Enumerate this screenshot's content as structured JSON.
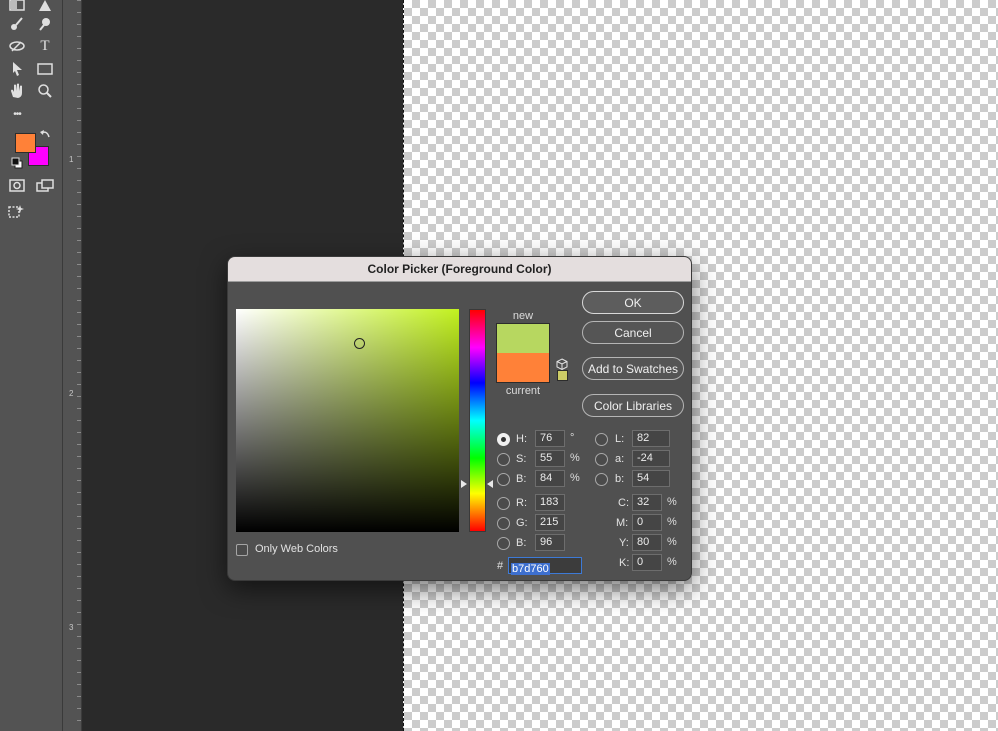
{
  "toolbar": {
    "tools": [
      "gradient-tool",
      "shape-triangle-tool",
      "brush-tool",
      "smudge-tool",
      "pen-tool",
      "type-tool",
      "path-selection-tool",
      "rectangle-tool",
      "hand-tool",
      "zoom-tool",
      "more-tools",
      "quick-mask",
      "screen-mode",
      "content-aware"
    ],
    "type_tool_glyph": "T",
    "more_glyph": "•••",
    "foreground_color": "#ff8138",
    "background_color": "#ff00ff"
  },
  "ruler": {
    "marks": [
      "1",
      "2",
      "3"
    ]
  },
  "dialog": {
    "title": "Color Picker (Foreground Color)",
    "labels": {
      "new": "new",
      "current": "current",
      "only_web_colors": "Only Web Colors",
      "hash": "#"
    },
    "buttons": {
      "ok": "OK",
      "cancel": "Cancel",
      "add_to_swatches": "Add to Swatches",
      "color_libraries": "Color Libraries"
    },
    "new_color": "#b7d760",
    "current_color": "#ff8138",
    "hue_base_color": "#c2f11f",
    "websafe_color": "#cccc66",
    "hsb": {
      "h_label": "H:",
      "h_value": "76",
      "h_unit": "°",
      "s_label": "S:",
      "s_value": "55",
      "s_unit": "%",
      "b_label": "B:",
      "b_value": "84",
      "b_unit": "%"
    },
    "rgb": {
      "r_label": "R:",
      "r_value": "183",
      "g_label": "G:",
      "g_value": "215",
      "b_label": "B:",
      "b_value": "96"
    },
    "lab": {
      "l_label": "L:",
      "l_value": "82",
      "a_label": "a:",
      "a_value": "-24",
      "b_label": "b:",
      "b_value": "54"
    },
    "cmyk": {
      "c_label": "C:",
      "c_value": "32",
      "m_label": "M:",
      "m_value": "0",
      "y_label": "Y:",
      "y_value": "80",
      "k_label": "K:",
      "k_value": "0",
      "unit": "%"
    },
    "hex_value": "b7d760",
    "selected_channel": "H"
  }
}
